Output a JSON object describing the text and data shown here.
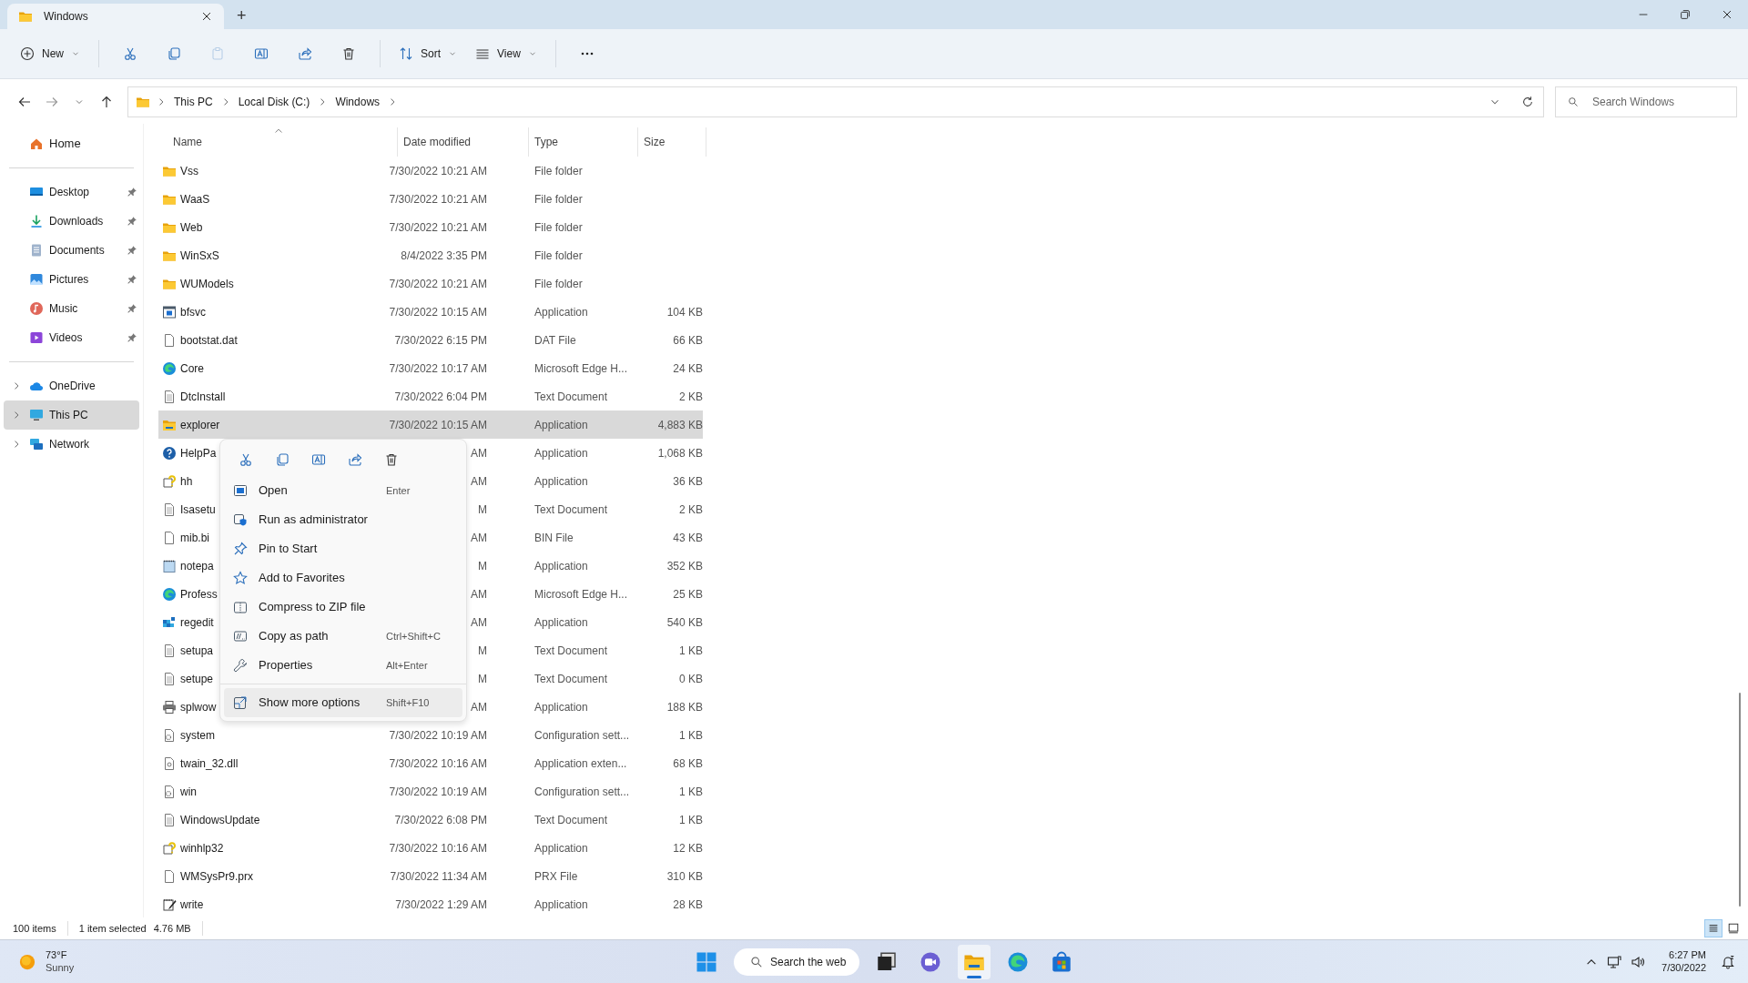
{
  "window": {
    "tab_title": "Windows",
    "new_tab": "+"
  },
  "toolbar": [
    {
      "kind": "new",
      "label": "New",
      "disabled": false
    },
    {
      "kind": "cut",
      "disabled": false
    },
    {
      "kind": "copy",
      "disabled": false
    },
    {
      "kind": "paste",
      "disabled": true
    },
    {
      "kind": "rename",
      "disabled": false
    },
    {
      "kind": "share",
      "disabled": false
    },
    {
      "kind": "delete",
      "disabled": false
    },
    {
      "kind": "sort",
      "label": "Sort",
      "disabled": false
    },
    {
      "kind": "view",
      "label": "View",
      "disabled": false
    },
    {
      "kind": "more",
      "disabled": false
    }
  ],
  "breadcrumb": [
    "This PC",
    "Local Disk (C:)",
    "Windows"
  ],
  "search": {
    "placeholder": "Search Windows"
  },
  "sidebar": {
    "groups": [
      [
        {
          "label": "Home",
          "pinned": false,
          "expandable": false,
          "selected": false
        }
      ],
      [
        {
          "label": "Desktop",
          "pinned": true,
          "expandable": false,
          "selected": false
        },
        {
          "label": "Downloads",
          "pinned": true,
          "expandable": false,
          "selected": false
        },
        {
          "label": "Documents",
          "pinned": true,
          "expandable": false,
          "selected": false
        },
        {
          "label": "Pictures",
          "pinned": true,
          "expandable": false,
          "selected": false
        },
        {
          "label": "Music",
          "pinned": true,
          "expandable": false,
          "selected": false
        },
        {
          "label": "Videos",
          "pinned": true,
          "expandable": false,
          "selected": false
        }
      ],
      [
        {
          "label": "OneDrive",
          "pinned": false,
          "expandable": true,
          "selected": false
        },
        {
          "label": "This PC",
          "pinned": false,
          "expandable": true,
          "selected": true
        },
        {
          "label": "Network",
          "pinned": false,
          "expandable": true,
          "selected": false
        }
      ]
    ]
  },
  "table": {
    "columns": [
      "Name",
      "Date modified",
      "Type",
      "Size"
    ],
    "rows": [
      {
        "kind": "folder",
        "name": "Vss",
        "date": "7/30/2022 10:21 AM",
        "type": "File folder",
        "selected": false
      },
      {
        "kind": "folder",
        "name": "WaaS",
        "date": "7/30/2022 10:21 AM",
        "type": "File folder",
        "selected": false
      },
      {
        "kind": "folder",
        "name": "Web",
        "date": "7/30/2022 10:21 AM",
        "type": "File folder",
        "selected": false
      },
      {
        "kind": "folder",
        "name": "WinSxS",
        "date": "8/4/2022 3:35 PM",
        "type": "File folder",
        "selected": false
      },
      {
        "kind": "folder",
        "name": "WUModels",
        "date": "7/30/2022 10:21 AM",
        "type": "File folder",
        "selected": false
      },
      {
        "kind": "app",
        "name": "bfsvc",
        "date": "7/30/2022 10:15 AM",
        "type": "Application",
        "size": "104 KB",
        "selected": false
      },
      {
        "kind": "blank",
        "name": "bootstat.dat",
        "date": "7/30/2022 6:15 PM",
        "type": "DAT File",
        "size": "66 KB",
        "selected": false
      },
      {
        "kind": "edge",
        "name": "Core",
        "date": "7/30/2022 10:17 AM",
        "type": "Microsoft Edge H...",
        "size": "24 KB",
        "selected": false
      },
      {
        "kind": "text",
        "name": "DtcInstall",
        "date": "7/30/2022 6:04 PM",
        "type": "Text Document",
        "size": "2 KB",
        "selected": false
      },
      {
        "kind": "explorer",
        "name": "explorer",
        "date": "7/30/2022 10:15 AM",
        "type": "Application",
        "size": "4,883 KB",
        "selected": true
      },
      {
        "kind": "help",
        "name": "HelpPa",
        "date": "AM",
        "type": "Application",
        "size": "1,068 KB",
        "selected": false
      },
      {
        "kind": "hh",
        "name": "hh",
        "date": "AM",
        "type": "Application",
        "size": "36 KB",
        "selected": false
      },
      {
        "kind": "text",
        "name": "Isasetu",
        "date": "M",
        "type": "Text Document",
        "size": "2 KB",
        "selected": false
      },
      {
        "kind": "blank",
        "name": "mib.bi",
        "date": "AM",
        "type": "BIN File",
        "size": "43 KB",
        "selected": false
      },
      {
        "kind": "notepad",
        "name": "notepa",
        "date": "M",
        "type": "Application",
        "size": "352 KB",
        "selected": false
      },
      {
        "kind": "edge",
        "name": "Profess",
        "date": "AM",
        "type": "Microsoft Edge H...",
        "size": "25 KB",
        "selected": false
      },
      {
        "kind": "regedit",
        "name": "regedit",
        "date": "AM",
        "type": "Application",
        "size": "540 KB",
        "selected": false
      },
      {
        "kind": "text",
        "name": "setupa",
        "date": "M",
        "type": "Text Document",
        "size": "1 KB",
        "selected": false
      },
      {
        "kind": "text",
        "name": "setupe",
        "date": "M",
        "type": "Text Document",
        "size": "0 KB",
        "selected": false
      },
      {
        "kind": "printer",
        "name": "splwow",
        "date": "AM",
        "type": "Application",
        "size": "188 KB",
        "selected": false
      },
      {
        "kind": "config",
        "name": "system",
        "date": "7/30/2022 10:19 AM",
        "type": "Configuration sett...",
        "size": "1 KB",
        "selected": false
      },
      {
        "kind": "dll",
        "name": "twain_32.dll",
        "date": "7/30/2022 10:16 AM",
        "type": "Application exten...",
        "size": "68 KB",
        "selected": false
      },
      {
        "kind": "config",
        "name": "win",
        "date": "7/30/2022 10:19 AM",
        "type": "Configuration sett...",
        "size": "1 KB",
        "selected": false
      },
      {
        "kind": "text",
        "name": "WindowsUpdate",
        "date": "7/30/2022 6:08 PM",
        "type": "Text Document",
        "size": "1 KB",
        "selected": false
      },
      {
        "kind": "hh",
        "name": "winhlp32",
        "date": "7/30/2022 10:16 AM",
        "type": "Application",
        "size": "12 KB",
        "selected": false
      },
      {
        "kind": "blank",
        "name": "WMSysPr9.prx",
        "date": "7/30/2022 11:34 AM",
        "type": "PRX File",
        "size": "310 KB",
        "selected": false
      },
      {
        "kind": "write",
        "name": "write",
        "date": "7/30/2022 1:29 AM",
        "type": "Application",
        "size": "28 KB",
        "selected": false
      }
    ]
  },
  "context_menu": {
    "quick_actions": [
      {
        "kind": "cut"
      },
      {
        "kind": "copy"
      },
      {
        "kind": "rename"
      },
      {
        "kind": "share"
      },
      {
        "kind": "delete"
      }
    ],
    "items": [
      {
        "label": "Open",
        "shortcut": "Enter",
        "selected": false
      },
      {
        "label": "Run as administrator",
        "selected": false
      },
      {
        "label": "Pin to Start",
        "selected": false
      },
      {
        "label": "Add to Favorites",
        "selected": false
      },
      {
        "label": "Compress to ZIP file",
        "selected": false
      },
      {
        "label": "Copy as path",
        "shortcut": "Ctrl+Shift+C",
        "selected": false
      },
      {
        "label": "Properties",
        "shortcut": "Alt+Enter",
        "selected": false
      }
    ],
    "more": {
      "label": "Show more options",
      "shortcut": "Shift+F10",
      "selected": true
    }
  },
  "status_bar": {
    "count": "100 items",
    "selection": "1 item selected",
    "size": "4.76 MB",
    "views": [
      {
        "kind": "details",
        "selected": true
      },
      {
        "kind": "tiles",
        "selected": false
      }
    ]
  },
  "taskbar": {
    "weather": {
      "temperature": "73°F",
      "condition": "Sunny"
    },
    "search": "Search the web",
    "apps": [
      {
        "kind": "start",
        "active": false
      },
      {
        "kind": "taskview",
        "active": false
      },
      {
        "kind": "chat",
        "active": false
      },
      {
        "kind": "explorer",
        "active": true
      },
      {
        "kind": "edge",
        "active": false
      },
      {
        "kind": "store",
        "active": false
      }
    ],
    "time": "6:27 PM",
    "date": "7/30/2022"
  }
}
